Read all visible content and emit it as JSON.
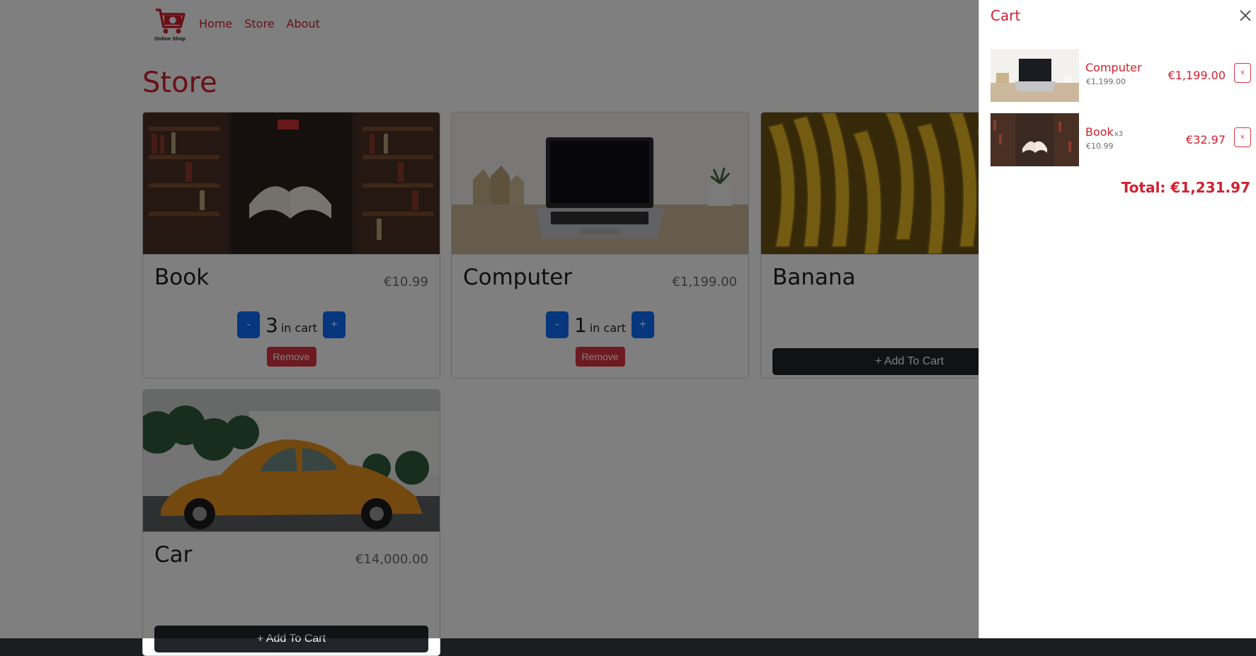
{
  "nav": {
    "logo_text": "Online Shop",
    "links": [
      "Home",
      "Store",
      "About"
    ]
  },
  "store": {
    "title": "Store",
    "items": [
      {
        "name": "Book",
        "price": "€10.99",
        "quantity": "3",
        "in_cart_label": "in cart",
        "minus": "-",
        "plus": "+",
        "remove_label": "Remove"
      },
      {
        "name": "Computer",
        "price": "€1,199.00",
        "quantity": "1",
        "in_cart_label": "in cart",
        "minus": "-",
        "plus": "+",
        "remove_label": "Remove"
      },
      {
        "name": "Banana",
        "add_label": "+ Add To Cart"
      },
      {
        "name": "Car",
        "price": "€14,000.00",
        "add_label": "+ Add To Cart"
      }
    ]
  },
  "cart": {
    "title": "Cart",
    "items": [
      {
        "name": "Computer",
        "qty_label": "",
        "unit_price": "€1,199.00",
        "line_total": "€1,199.00",
        "remove": "×"
      },
      {
        "name": "Book",
        "qty_label": "x3",
        "unit_price": "€10.99",
        "line_total": "€32.97",
        "remove": "×"
      }
    ],
    "total": "Total: €1,231.97"
  },
  "colors": {
    "accent": "#d22030",
    "primary_button": "#0d6efd",
    "danger": "#dc3545",
    "dark_button": "#212529",
    "backdrop": "rgba(0,0,0,0.5)"
  }
}
